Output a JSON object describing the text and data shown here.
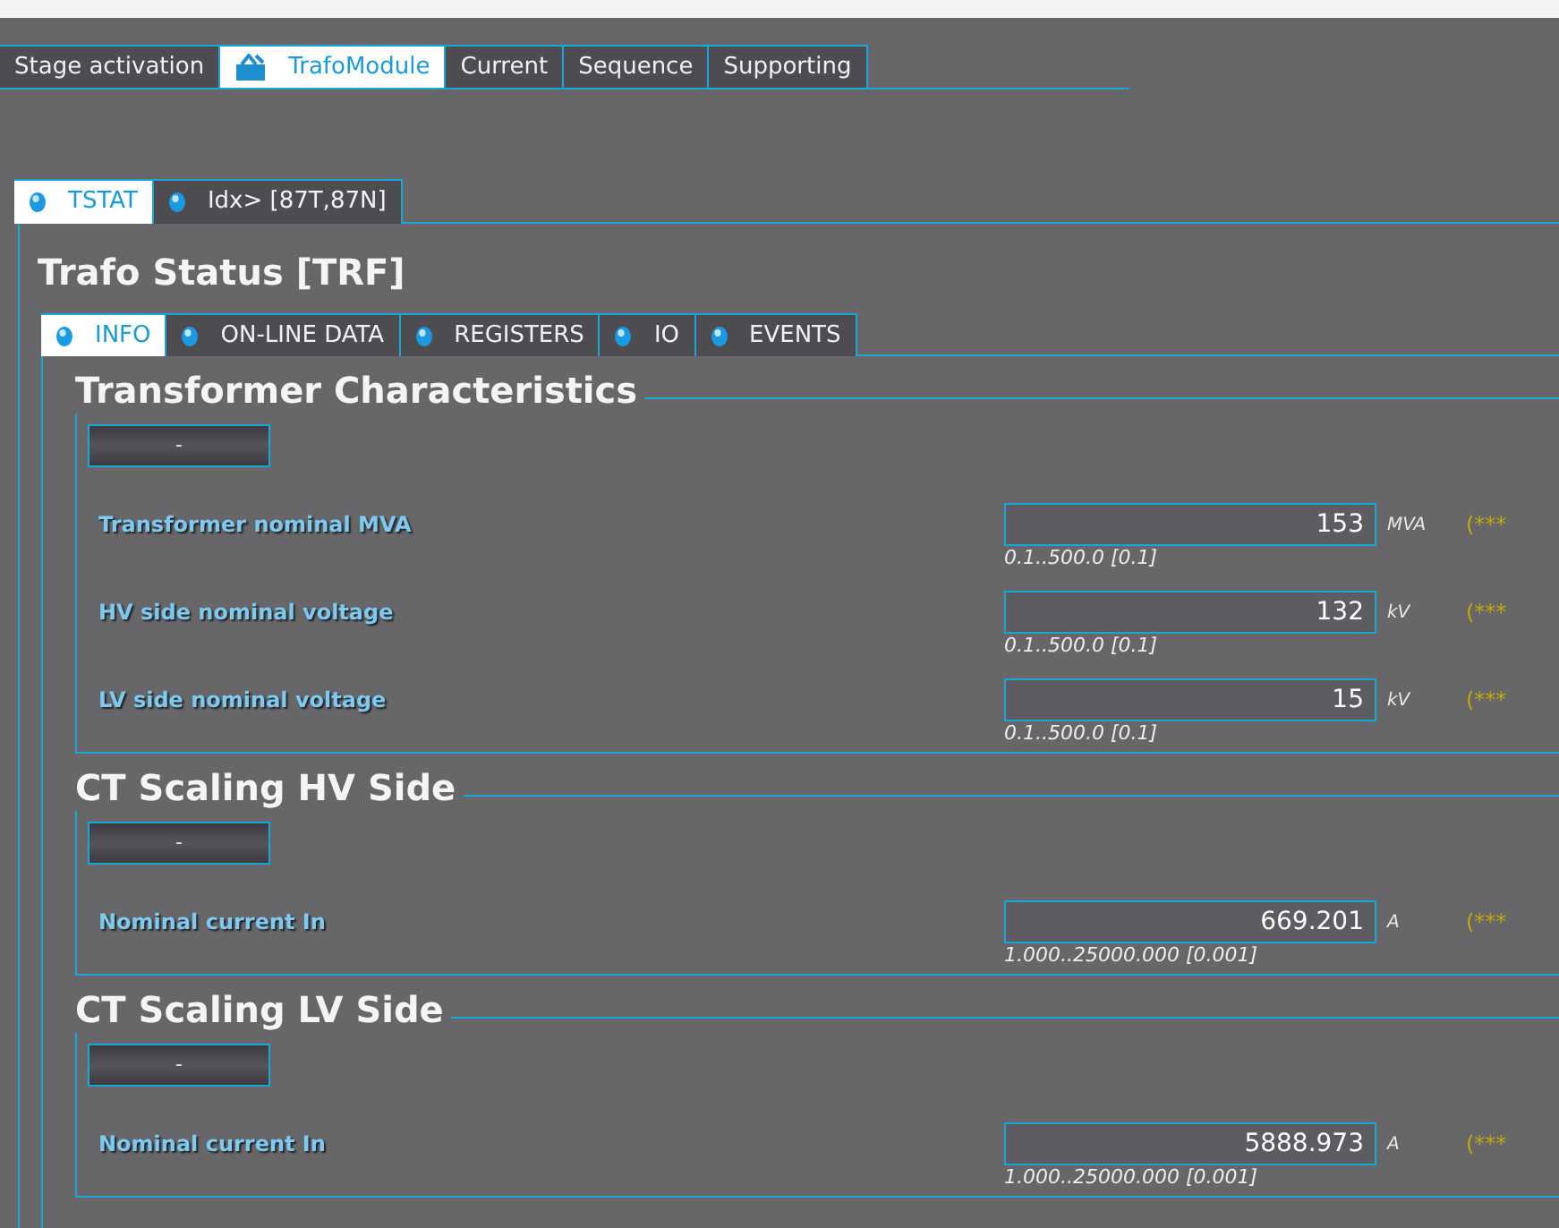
{
  "top_tabs": [
    {
      "label": "Stage activation",
      "selected": false
    },
    {
      "label": "TrafoModule",
      "selected": true
    },
    {
      "label": "Current",
      "selected": false
    },
    {
      "label": "Sequence",
      "selected": false
    },
    {
      "label": "Supporting",
      "selected": false
    }
  ],
  "function_tabs": [
    {
      "label": "TSTAT",
      "selected": true
    },
    {
      "label": "Idx> [87T,87N]",
      "selected": false
    }
  ],
  "title": "Trafo Status [TRF]",
  "page_tabs": [
    {
      "label": "INFO",
      "selected": true
    },
    {
      "label": "ON-LINE DATA",
      "selected": false
    },
    {
      "label": "REGISTERS",
      "selected": false
    },
    {
      "label": "IO",
      "selected": false
    },
    {
      "label": "EVENTS",
      "selected": false
    }
  ],
  "sections": [
    {
      "title": "Transformer Characteristics",
      "button": "-",
      "settings": [
        {
          "label": "Transformer nominal MVA",
          "value": "153",
          "unit": "MVA",
          "range": "0.1..500.0 [0.1]",
          "note": "(***"
        },
        {
          "label": "HV side nominal voltage",
          "value": "132",
          "unit": "kV",
          "range": "0.1..500.0 [0.1]",
          "note": "(***"
        },
        {
          "label": "LV side nominal voltage",
          "value": "15",
          "unit": "kV",
          "range": "0.1..500.0 [0.1]",
          "note": "(***"
        }
      ]
    },
    {
      "title": "CT Scaling HV Side",
      "button": "-",
      "settings": [
        {
          "label": "Nominal current In",
          "value": "669.201",
          "unit": "A",
          "range": "1.000..25000.000 [0.001]",
          "note": "(***"
        }
      ]
    },
    {
      "title": "CT Scaling LV Side",
      "button": "-",
      "settings": [
        {
          "label": "Nominal current In",
          "value": "5888.973",
          "unit": "A",
          "range": "1.000..25000.000 [0.001]",
          "note": "(***"
        }
      ]
    }
  ]
}
